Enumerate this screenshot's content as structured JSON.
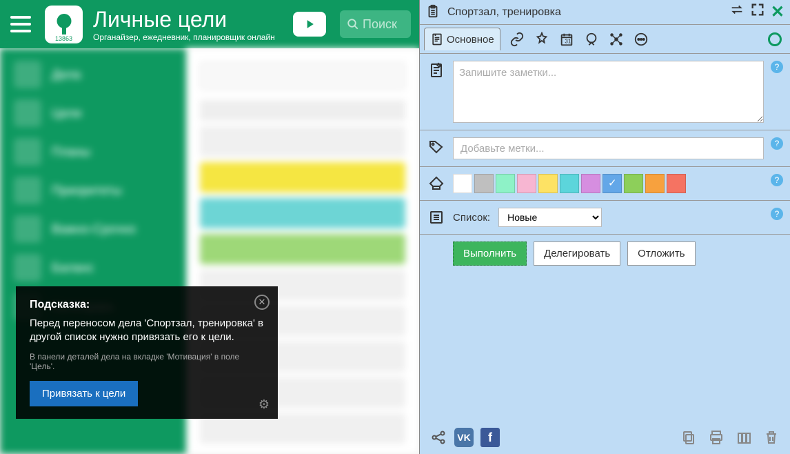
{
  "header": {
    "title": "Личные цели",
    "subtitle": "Органайзер, ежедневник, планировщик онлайн",
    "logo_count": "13863",
    "search_placeholder": "Поиск"
  },
  "hint": {
    "title": "Подсказка:",
    "body": "Перед переносом дела 'Спортзал, тренировка' в другой список нужно привязать его к цели.",
    "sub": "В панели деталей дела на вкладке 'Мотивация' в поле 'Цель'.",
    "button": "Привязать к цели"
  },
  "panel": {
    "title": "Спортзал, тренировка",
    "tab_main": "Основное",
    "notes_placeholder": "Запишите заметки...",
    "tags_placeholder": "Добавьте метки...",
    "list_label": "Список:",
    "list_value": "Новые",
    "btn_complete": "Выполнить",
    "btn_delegate": "Делегировать",
    "btn_postpone": "Отложить",
    "colors": [
      "#ffffff",
      "#bfbfbf",
      "#8ef2c7",
      "#f7b6d2",
      "#fde264",
      "#5cd5db",
      "#d68ee0",
      "#63a7e8",
      "#8dcf5a",
      "#f7a13e",
      "#f57362"
    ],
    "selected_color_index": 7,
    "social_vk": "VK",
    "social_fb": "f"
  }
}
